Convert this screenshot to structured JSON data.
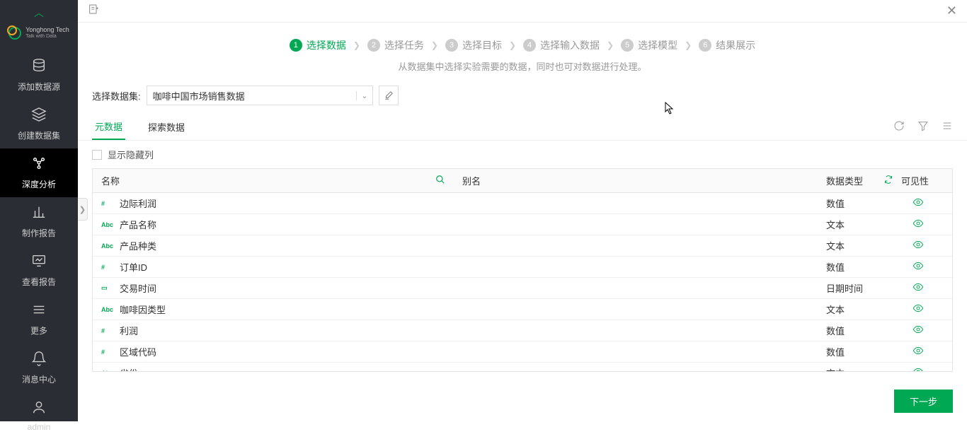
{
  "brand": {
    "name": "Yonghong Tech",
    "tagline": "Talk with Data"
  },
  "sidebar": {
    "items": [
      {
        "label": "添加数据源"
      },
      {
        "label": "创建数据集"
      },
      {
        "label": "深度分析"
      },
      {
        "label": "制作报告"
      },
      {
        "label": "查看报告"
      },
      {
        "label": "更多"
      },
      {
        "label": "消息中心"
      },
      {
        "label": "admin"
      }
    ]
  },
  "wizard": {
    "steps": [
      {
        "num": "1",
        "label": "选择数据"
      },
      {
        "num": "2",
        "label": "选择任务"
      },
      {
        "num": "3",
        "label": "选择目标"
      },
      {
        "num": "4",
        "label": "选择输入数据"
      },
      {
        "num": "5",
        "label": "选择模型"
      },
      {
        "num": "6",
        "label": "结果展示"
      }
    ],
    "subtitle": "从数据集中选择实验需要的数据，同时也可对数据进行处理。"
  },
  "dataset": {
    "label": "选择数据集:",
    "value": "咖啡中国市场销售数据"
  },
  "tabs": {
    "meta": "元数据",
    "explore": "探索数据"
  },
  "hiddenCols": "显示隐藏列",
  "tableHeader": {
    "name": "名称",
    "alias": "别名",
    "dtype": "数据类型",
    "visibility": "可见性"
  },
  "rows": [
    {
      "icon": "#",
      "iconClass": "type-num",
      "name": "边际利润",
      "dtype": "数值"
    },
    {
      "icon": "Abc",
      "iconClass": "type-abc",
      "name": "产品名称",
      "dtype": "文本"
    },
    {
      "icon": "Abc",
      "iconClass": "type-abc",
      "name": "产品种类",
      "dtype": "文本"
    },
    {
      "icon": "#",
      "iconClass": "type-num",
      "name": "订单ID",
      "dtype": "数值"
    },
    {
      "icon": "▭",
      "iconClass": "type-date",
      "name": "交易时间",
      "dtype": "日期时间"
    },
    {
      "icon": "Abc",
      "iconClass": "type-abc",
      "name": "咖啡因类型",
      "dtype": "文本"
    },
    {
      "icon": "#",
      "iconClass": "type-num",
      "name": "利润",
      "dtype": "数值"
    },
    {
      "icon": "#",
      "iconClass": "type-num",
      "name": "区域代码",
      "dtype": "数值"
    },
    {
      "icon": "Abc",
      "iconClass": "type-abc",
      "name": "省份",
      "dtype": "文本"
    }
  ],
  "footer": {
    "next": "下一步"
  }
}
